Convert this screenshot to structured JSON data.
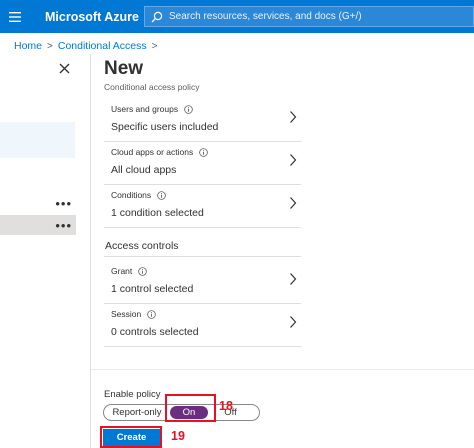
{
  "topbar": {
    "brand": "Microsoft Azure",
    "search_placeholder": "Search resources, services, and docs (G+/)"
  },
  "breadcrumb": [
    {
      "label": "Home"
    },
    {
      "label": "Conditional Access"
    }
  ],
  "blade": {
    "title": "New",
    "subtitle": "Conditional access policy",
    "assignments": [
      {
        "label": "Users and groups",
        "value": "Specific users included"
      },
      {
        "label": "Cloud apps or actions",
        "value": "All cloud apps"
      },
      {
        "label": "Conditions",
        "value": "1 condition selected"
      }
    ],
    "access_controls_header": "Access controls",
    "controls": [
      {
        "label": "Grant",
        "value": "1 control selected"
      },
      {
        "label": "Session",
        "value": "0 controls selected"
      }
    ],
    "enable_policy": {
      "label": "Enable policy",
      "options": [
        "Report-only",
        "On",
        "Off"
      ],
      "selected": "On"
    },
    "create_label": "Create"
  },
  "annotations": {
    "step_18": "18",
    "step_19": "19"
  },
  "colors": {
    "topbar": "#0078d4",
    "toggle_selected": "#6b2d7e",
    "annotation": "#e81123",
    "primary_button": "#0078d4"
  }
}
